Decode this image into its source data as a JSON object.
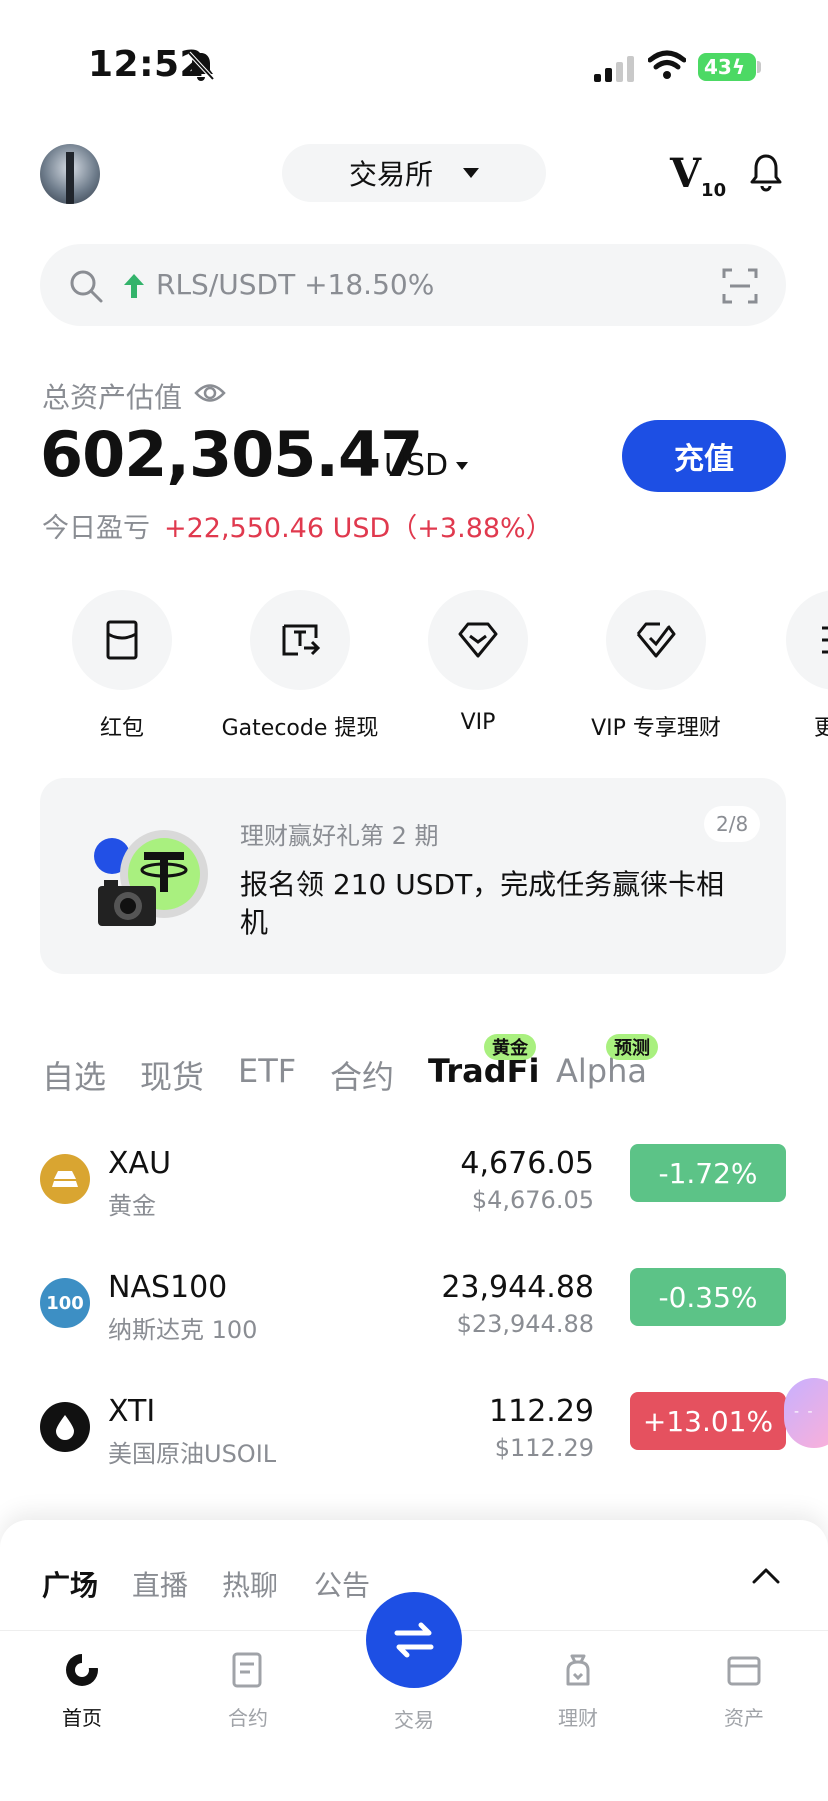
{
  "status_bar": {
    "time": "12:52",
    "battery": "43"
  },
  "header": {
    "exchange_label": "交易所",
    "vip_level": "V",
    "vip_num": "10"
  },
  "search": {
    "trending_text": "RLS/USDT +18.50%"
  },
  "assets": {
    "label": "总资产估值",
    "total": "602,305.47",
    "currency": "USD",
    "deposit_label": "充值",
    "pnl_label": "今日盈亏",
    "pnl_value": "+22,550.46 USD（+3.88%）"
  },
  "quick_actions": [
    {
      "label": "红包",
      "icon": "red-envelope-icon"
    },
    {
      "label": "Gatecode 提现",
      "icon": "gatecode-icon"
    },
    {
      "label": "VIP",
      "icon": "diamond-icon"
    },
    {
      "label": "VIP 专享理财",
      "icon": "vip-wealth-icon"
    },
    {
      "label": "更",
      "icon": "more-icon"
    }
  ],
  "banner": {
    "subtitle": "理财赢好礼第 2 期",
    "title": "报名领 210 USDT，完成任务赢徕卡相机",
    "page": "2/8"
  },
  "market_tabs": [
    {
      "label": "自选"
    },
    {
      "label": "现货"
    },
    {
      "label": "ETF"
    },
    {
      "label": "合约"
    },
    {
      "label": "TradFi",
      "badge": "黄金",
      "active": true
    },
    {
      "label": "Alpha",
      "badge": "预测"
    }
  ],
  "market_rows": [
    {
      "symbol": "XAU",
      "name": "黄金",
      "price": "4,676.05",
      "usd": "$4,676.05",
      "change": "-1.72%",
      "direction": "down",
      "icon_color": "#d9a531"
    },
    {
      "symbol": "NAS100",
      "name": "纳斯达克 100",
      "price": "23,944.88",
      "usd": "$23,944.88",
      "change": "-0.35%",
      "direction": "down",
      "icon_color": "#3d8fc4",
      "icon_text": "100"
    },
    {
      "symbol": "XTI",
      "name": "美国原油USOIL",
      "price": "112.29",
      "usd": "$112.29",
      "change": "+13.01%",
      "direction": "up",
      "icon_color": "#111111"
    }
  ],
  "sheet": {
    "tabs": [
      "广场",
      "直播",
      "热聊",
      "公告"
    ]
  },
  "nav": {
    "items": [
      "首页",
      "合约",
      "交易",
      "理财",
      "资产"
    ]
  },
  "colors": {
    "accent": "#1d4fe4",
    "up": "#e5515f",
    "down": "#5cc387",
    "badge": "#a9f07f"
  }
}
